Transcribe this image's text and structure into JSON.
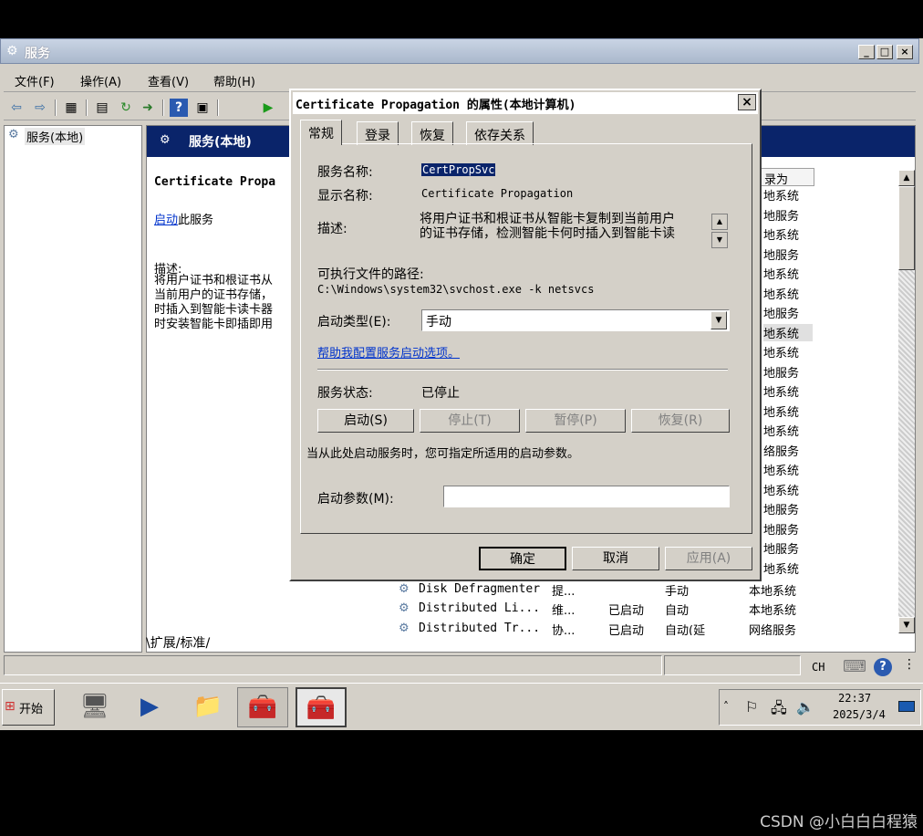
{
  "window": {
    "title": "服务"
  },
  "menu": [
    "文件(F)",
    "操作(A)",
    "查看(V)",
    "帮助(H)"
  ],
  "tree": {
    "root": "服务(本地)"
  },
  "detail": {
    "header": "服务(本地)",
    "service_name_cut": "Certificate Propa",
    "start_link": "启动",
    "start_suffix": "此服务",
    "desc_label": "描述:",
    "desc_lines": [
      "将用户证书和根证书从",
      "当前用户的证书存储，",
      "时插入到智能卡读卡器",
      "时安装智能卡即插即用"
    ]
  },
  "list": {
    "col_header_logon": "录为",
    "logon_col": [
      "地系统",
      "地服务",
      "地系统",
      "地服务",
      "地系统",
      "地系统",
      "地服务",
      "地系统",
      "地系统",
      "地服务",
      "地系统",
      "地系统",
      "地系统",
      "络服务",
      "地系统",
      "地系统",
      "地服务",
      "地服务",
      "地服务",
      "地系统"
    ],
    "rows": [
      {
        "name": "Disk Defragmenter",
        "desc": "提...",
        "status": "",
        "startup": "手动",
        "logon": "本地系统"
      },
      {
        "name": "Distributed Li...",
        "desc": "维...",
        "status": "已启动",
        "startup": "自动",
        "logon": "本地系统"
      },
      {
        "name": "Distributed Tr...",
        "desc": "协...",
        "status": "已启动",
        "startup": "自动(延",
        "logon": "网络服务"
      }
    ]
  },
  "bottom_tabs": [
    "扩展",
    "标准"
  ],
  "dialog": {
    "title": "Certificate Propagation 的属性(本地计算机)",
    "close": "×",
    "tabs": [
      "常规",
      "登录",
      "恢复",
      "依存关系"
    ],
    "service_name_label": "服务名称:",
    "service_name": "CertPropSvc",
    "display_name_label": "显示名称:",
    "display_name": "Certificate Propagation",
    "desc_label": "描述:",
    "desc_lines": [
      "将用户证书和根证书从智能卡复制到当前用户",
      "的证书存储，检测智能卡何时插入到智能卡读"
    ],
    "path_label": "可执行文件的路径:",
    "path": "C:\\Windows\\system32\\svchost.exe -k netsvcs",
    "startup_label": "启动类型(E):",
    "startup_value": "手动",
    "help_link": "帮助我配置服务启动选项。",
    "status_label": "服务状态:",
    "status_value": "已停止",
    "btn_start": "启动(S)",
    "btn_stop": "停止(T)",
    "btn_pause": "暂停(P)",
    "btn_resume": "恢复(R)",
    "hint": "当从此处启动服务时，您可指定所适用的启动参数。",
    "param_label": "启动参数(M):",
    "param_value": "",
    "ok": "确定",
    "cancel": "取消",
    "apply": "应用(A)"
  },
  "statusbar": {
    "lang": "CH"
  },
  "taskbar": {
    "start": "开始",
    "time": "22:37",
    "date": "2025/3/4"
  },
  "watermark": "CSDN @小白白白程猿"
}
